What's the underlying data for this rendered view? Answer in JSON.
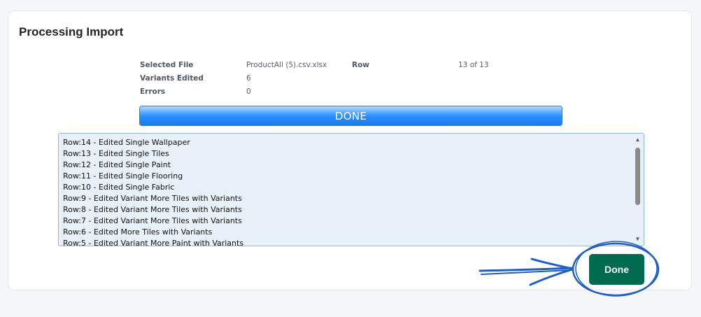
{
  "page": {
    "title": "Processing Import"
  },
  "summary": {
    "selected_file_label": "Selected File",
    "selected_file_value": "ProductAll (5).csv.xlsx",
    "row_label": "Row",
    "row_value": "13 of 13",
    "variants_edited_label": "Variants Edited",
    "variants_edited_value": "6",
    "errors_label": "Errors",
    "errors_value": "0"
  },
  "progress": {
    "label": "DONE",
    "percent": 100
  },
  "log": {
    "lines": [
      "Row:14 - Edited Single Wallpaper",
      "Row:13 - Edited Single Tiles",
      "Row:12 - Edited Single Paint",
      "Row:11 - Edited Single Flooring",
      "Row:10 - Edited Single Fabric",
      "Row:9 - Edited Variant More Tiles with Variants",
      "Row:8 - Edited Variant More Tiles with Variants",
      "Row:7 - Edited Variant More Tiles with Variants",
      "Row:6 - Edited More Tiles with Variants",
      "Row:5 - Edited Variant More Paint with Variants"
    ]
  },
  "actions": {
    "done_label": "Done"
  },
  "colors": {
    "done_button": "#006b4f",
    "progress_bar": "#1e88ff",
    "annotation": "#1f5fc4"
  },
  "icons": {
    "scroll_up": "triangle-up",
    "scroll_down": "triangle-down",
    "annotation_arrow": "hand-drawn-arrow",
    "annotation_circle": "hand-drawn-circle"
  }
}
